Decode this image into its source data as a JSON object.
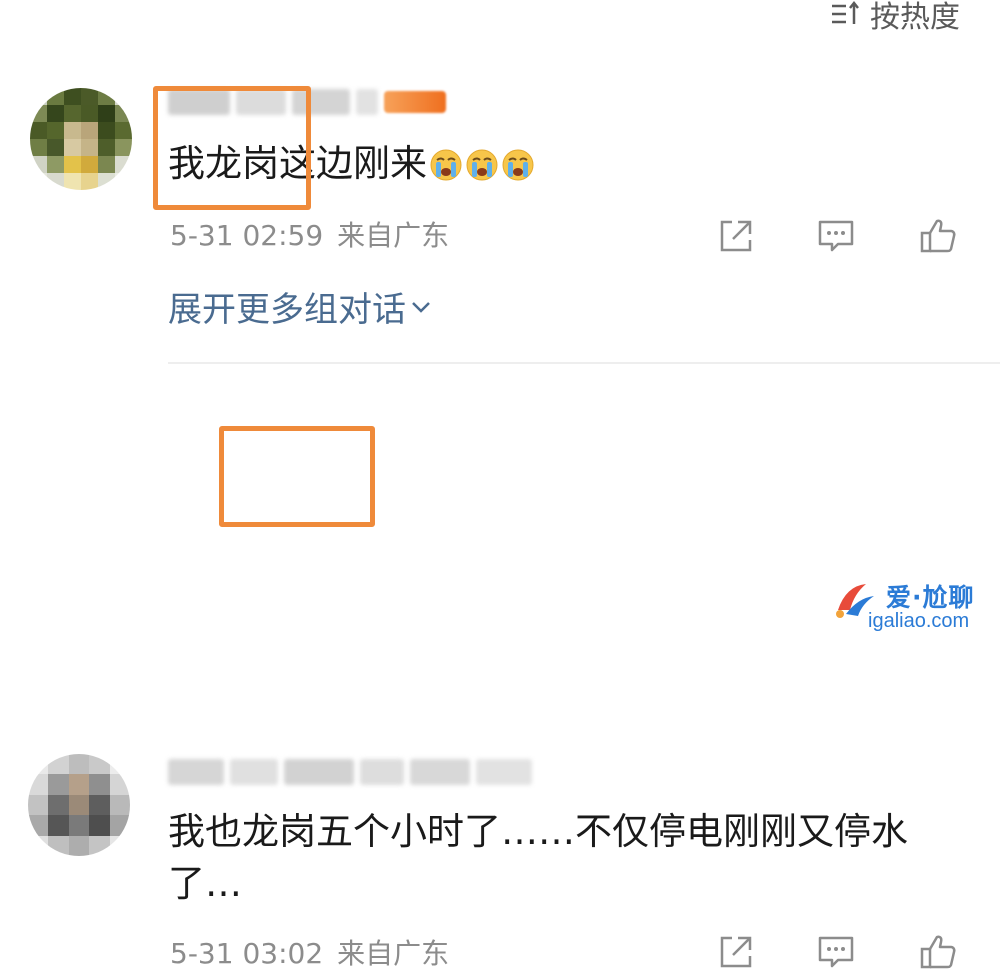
{
  "header": {
    "sort_label": "按热度"
  },
  "comments": [
    {
      "text_before": "我龙岗这边刚来",
      "emoji_count": 3,
      "emoji": "crying-face",
      "time": "5-31 02:59",
      "location": "来自广东",
      "expand_label": "展开更多组对话"
    },
    {
      "text": "我也龙岗五个小时了……不仅停电刚刚又停水了…",
      "time": "5-31 03:02",
      "location": "来自广东"
    }
  ],
  "watermark": {
    "text": "爱·尬聊",
    "url": "igaliao.com"
  },
  "colors": {
    "highlight": "#ef8a3a",
    "link": "#4a6b90",
    "meta": "#8c8c8c",
    "watermark": "#2b7bd6"
  }
}
